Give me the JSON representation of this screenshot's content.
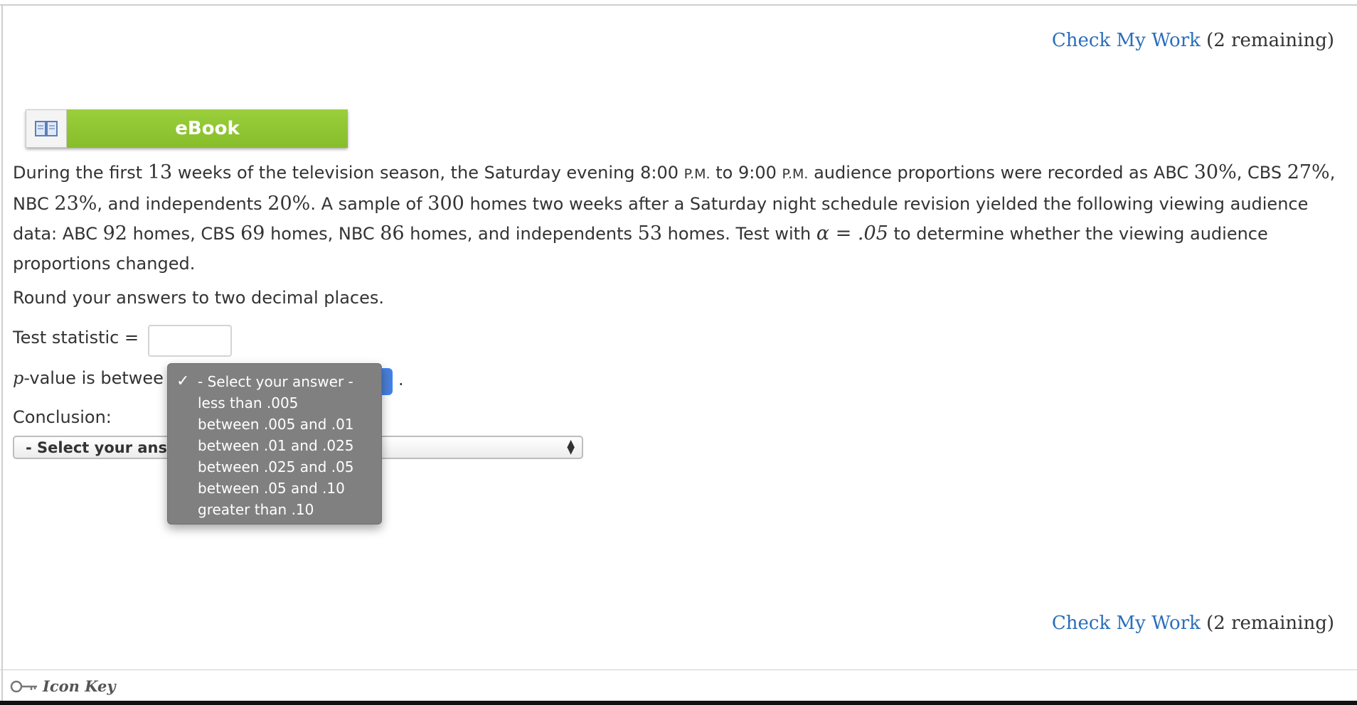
{
  "check_work": {
    "link_label": "Check My Work",
    "remaining": "(2 remaining)"
  },
  "ebook": {
    "label": "eBook",
    "icon": "book-icon"
  },
  "problem": {
    "s1": "During the first ",
    "n13": "13",
    "s2": " weeks of the television season, the Saturday evening 8:00 ",
    "pm1": "P.M.",
    "s3": " to 9:00 ",
    "pm2": "P.M.",
    "s4": " audience proportions were recorded as ABC ",
    "abc_pct": "30%",
    "s5": ", CBS ",
    "cbs_pct": "27%",
    "s6": ", NBC ",
    "nbc_pct": "23%",
    "s7": ", and independents ",
    "ind_pct": "20%",
    "s8": ". A sample of ",
    "sample": "300",
    "s9": " homes two weeks after a Saturday night schedule revision yielded the following viewing audience data: ABC ",
    "abc_n": "92",
    "s10": " homes, CBS ",
    "cbs_n": "69",
    "s11": " homes, NBC ",
    "nbc_n": "86",
    "s12": " homes, and independents ",
    "ind_n": "53",
    "s13": " homes. Test with ",
    "alpha": "α = .05",
    "s14": " to determine whether the viewing audience proportions changed."
  },
  "round_note": "Round your answers to two decimal places.",
  "test_statistic": {
    "label": "Test statistic =",
    "value": ""
  },
  "pvalue": {
    "p": "p",
    "label_rest": "-value is betwee",
    "period": "."
  },
  "conclusion": {
    "label": "Conclusion:",
    "selected": "- Select your answ"
  },
  "dropdown_options": [
    "- Select your answer -",
    "less than .005",
    "between .005 and .01",
    "between .01 and .025",
    "between .025 and .05",
    "between .05 and .10",
    "greater than .10"
  ],
  "dropdown_checkmark": "✓",
  "icon_key": {
    "label": "Icon Key",
    "icon": "key-icon"
  }
}
